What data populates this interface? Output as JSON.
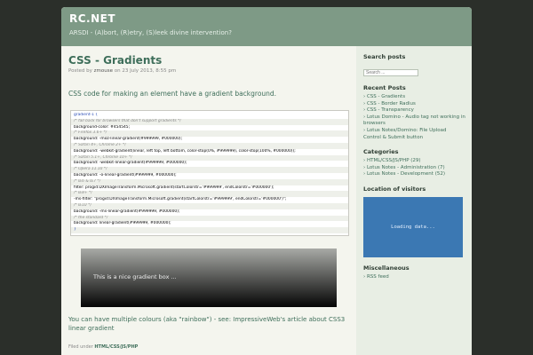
{
  "site": {
    "title": "RC.NET",
    "description": "ARSDI - (A)bort, (R)etry, (S)leek divine intervention?"
  },
  "post": {
    "title": "CSS - Gradients",
    "meta_prefix": "Posted by",
    "author": "zmouse",
    "meta_on": "on",
    "date": "23 July 2013, 8:55 pm",
    "intro": "CSS code for making an element have a gradient background.",
    "code_lines": [
      {
        "text": "gradient-1 {",
        "kind": "sel"
      },
      {
        "text": "  /* fall back for browsers that don't support gradients */",
        "kind": "com"
      },
      {
        "text": "  background-color: #454545;",
        "kind": "code"
      },
      {
        "text": "  /* Firefox 3.6+ */",
        "kind": "com"
      },
      {
        "text": "  background: -moz-linear-gradient(#999999, #000000);",
        "kind": "code"
      },
      {
        "text": "  /* Safari 4+, Chrome 2+ */",
        "kind": "com"
      },
      {
        "text": "  background: -webkit-gradient(linear, left top, left bottom, color-stop(0%, #999999), color-stop(100%, #000000));",
        "kind": "code"
      },
      {
        "text": "  /* Safari 5.1+, Chrome 10+ */",
        "kind": "com"
      },
      {
        "text": "  background: -webkit-linear-gradient(#999999, #000000);",
        "kind": "code"
      },
      {
        "text": "  /* Opera 11.10 */",
        "kind": "com"
      },
      {
        "text": "  background: -o-linear-gradient(#999999, #000000);",
        "kind": "code"
      },
      {
        "text": "  /* IE6 & IE7 */",
        "kind": "com"
      },
      {
        "text": "  filter: progid:DXImageTransform.Microsoft.gradient(startColorstr='#999999', endColorstr='#000000');",
        "kind": "code"
      },
      {
        "text": "  /* IE8+ */",
        "kind": "com"
      },
      {
        "text": "  -ms-filter: \"progid:DXImageTransform.Microsoft.gradient(startColorstr='#999999', endColorstr='#000000')\";",
        "kind": "code"
      },
      {
        "text": "  /* IE10 */",
        "kind": "com"
      },
      {
        "text": "  background: -ms-linear-gradient(#999999, #000000);",
        "kind": "code"
      },
      {
        "text": "  /* the standard */",
        "kind": "com"
      },
      {
        "text": "  background: linear-gradient(#999999, #000000);",
        "kind": "code"
      },
      {
        "text": "}",
        "kind": "sel"
      }
    ],
    "demo_text": "This is a nice gradient box ...",
    "multi_text": "You can have multiple colours (aka \"rainbow\") - see: ImpressiveWeb's article about CSS3 linear gradient",
    "filed_prefix": "Filed under",
    "filed_category": "HTML/CSS/JS/PHP"
  },
  "sidebar": {
    "search_heading": "Search posts",
    "search_placeholder": "Search ...",
    "recent_heading": "Recent Posts",
    "recent": [
      "CSS - Gradients",
      "CSS - Border Radius",
      "CSS - Transparency",
      "Lotus Domino - Audio tag not working in browsers",
      "Lotus Notes/Domino: File Upload Control & Submit button"
    ],
    "categories_heading": "Categories",
    "categories": [
      {
        "name": "HTML/CSS/JS/PHP",
        "count": "(29)"
      },
      {
        "name": "Lotus Notes - Administration",
        "count": "(7)"
      },
      {
        "name": "Lotus Notes - Development",
        "count": "(52)"
      }
    ],
    "visitors_heading": "Location of visitors",
    "map_text": "Loading data...",
    "misc_heading": "Miscellaneous",
    "misc": [
      "RSS feed"
    ]
  },
  "colors": {
    "header_bg": "#7e9a86",
    "accent_green": "#3e6e5a",
    "map_blue": "#3b78b3",
    "page_bg": "#2b2f2a"
  }
}
